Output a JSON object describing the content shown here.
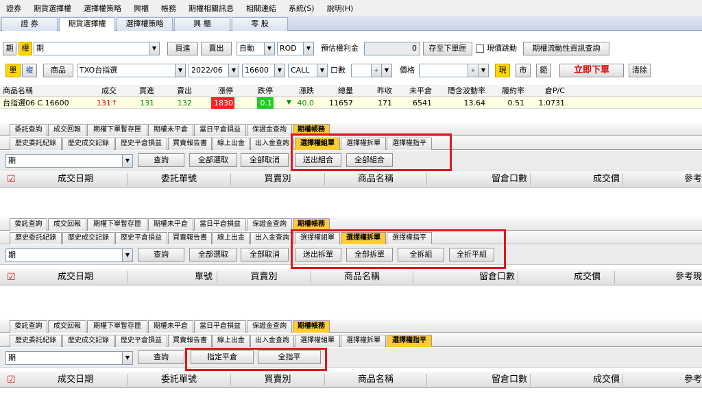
{
  "menu": [
    "證券",
    "期貨選擇權",
    "選擇權策略",
    "興櫃",
    "帳務",
    "期權相關訊息",
    "相關連結",
    "系統(S)",
    "說明(H)"
  ],
  "top_tabs": [
    "證 券",
    "期貨選擇權",
    "選擇權策略",
    "興 櫃",
    "零 股"
  ],
  "order": {
    "mode_fut": "期",
    "mode_opt": "權",
    "product_type": "期",
    "buy": "買進",
    "sell": "賣出",
    "auto": "自動",
    "rod": "ROD",
    "est_label": "預估權利金",
    "est_value": "0",
    "save_button": "存至下單匣",
    "live_price_label": "現價跳動",
    "vol_query": "期權流動性資訊查詢",
    "single": "單",
    "multi": "複",
    "product_button": "商品",
    "product": "TXO台指選",
    "month": "2022/06",
    "strike": "16600",
    "cp": "CALL",
    "qty_label": "口數",
    "price_label": "價格",
    "spot_button": "現",
    "market_button": "市",
    "range_button": "範",
    "submit_button": "立即下單",
    "clear_button": "清除"
  },
  "quote": {
    "headers": [
      "商品名稱",
      "成交",
      "買進",
      "賣出",
      "漲停",
      "跌停",
      "漲跌",
      "總量",
      "昨收",
      "未平倉",
      "隱含波動率",
      "履約率",
      "倉P/C"
    ],
    "row": {
      "name": "台指選06 C 16600",
      "last": "131",
      "last_arrow": "↑",
      "bid": "131",
      "ask": "132",
      "limit_up": "1830",
      "limit_down": "0.1",
      "change_arrow": "▼",
      "change": "40.0",
      "volume": "11657",
      "prev": "171",
      "oi": "6541",
      "iv": "13.64",
      "exercise": "0.51",
      "pc": "1.0731"
    }
  },
  "acct_tabs": [
    "委託查詢",
    "成交回報",
    "期權下單暫存匣",
    "期權未平倉",
    "當日平倉損益",
    "保證金查詢",
    "期權帳務"
  ],
  "history_tabs": [
    "歷史委託紀錄",
    "歷史成交記錄",
    "歷史平倉損益",
    "買賣報告書",
    "線上出金",
    "出入金查詢",
    "選擇權組單",
    "選擇權拆單",
    "選擇權指平"
  ],
  "panels": [
    {
      "select": "期",
      "query": "查詢",
      "select_all": "全部選取",
      "deselect_all": "全部取消",
      "actions": [
        "送出組合",
        "全部組合"
      ],
      "cols": [
        "成交日期",
        "委託單號",
        "買賣別",
        "商品名稱",
        "留倉口數",
        "成交價",
        "參考"
      ]
    },
    {
      "select": "期",
      "query": "查詢",
      "select_all": "全部選取",
      "deselect_all": "全部取消",
      "actions": [
        "送出拆單",
        "全部拆單",
        "全拆組",
        "全折平組"
      ],
      "cols": [
        "成交日期",
        "單號",
        "買賣別",
        "商品名稱",
        "留倉口數",
        "成交價",
        "參考現"
      ]
    },
    {
      "select": "期",
      "query": "查詢",
      "actions": [
        "指定平倉",
        "全指平"
      ],
      "cols": [
        "成交日期",
        "委託單號",
        "買賣別",
        "商品名稱",
        "留倉口數",
        "成交價",
        "參考"
      ]
    }
  ],
  "colors": {
    "highlight": "#e3141b",
    "active_tab": "#ffcc33",
    "limit_up_bg": "#ff2222",
    "limit_down_bg": "#22cc22"
  }
}
